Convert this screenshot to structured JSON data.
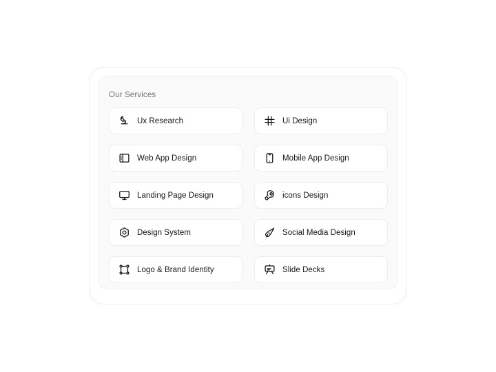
{
  "panel": {
    "title": "Our Services",
    "background_color": "#fafafa",
    "border_color": "#efeff1",
    "item_background_color": "#ffffff",
    "item_border_color": "#ededef",
    "title_color": "#6f7277",
    "label_color": "#15161a",
    "icon_color": "#111214"
  },
  "services": [
    {
      "label": "Ux Research",
      "icon": "microscope-icon"
    },
    {
      "label": "Ui Design",
      "icon": "crosshair-frame-icon"
    },
    {
      "label": "Web App Design",
      "icon": "layout-panel-left-icon"
    },
    {
      "label": "Mobile App Design",
      "icon": "smartphone-icon"
    },
    {
      "label": "Landing Page Design",
      "icon": "monitor-icon"
    },
    {
      "label": "icons Design",
      "icon": "pen-tool-icon"
    },
    {
      "label": "Design System",
      "icon": "hexagon-component-icon"
    },
    {
      "label": "Social Media Design",
      "icon": "megaphone-icon"
    },
    {
      "label": "Logo & Brand Identity",
      "icon": "frame-corners-icon"
    },
    {
      "label": "Slide Decks",
      "icon": "presentation-easel-icon"
    }
  ]
}
